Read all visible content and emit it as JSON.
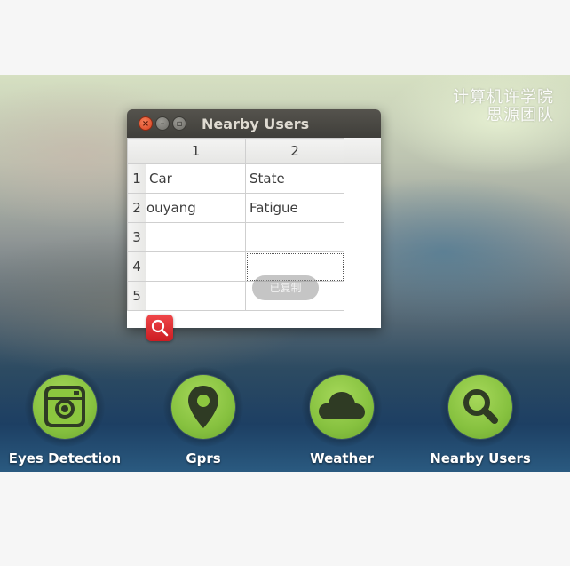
{
  "watermark": {
    "line1": "计算机许学院",
    "line2": "思源团队"
  },
  "window": {
    "title": "Nearby Users",
    "close_glyph": "×",
    "minimize_glyph": "–",
    "maximize_glyph": "▫"
  },
  "table": {
    "columns": [
      "1",
      "2"
    ],
    "rows": [
      {
        "header": "1",
        "cells": [
          "Car",
          "State"
        ]
      },
      {
        "header": "2",
        "cells": [
          "ouyang",
          "Fatigue"
        ]
      },
      {
        "header": "3",
        "cells": [
          "",
          ""
        ]
      },
      {
        "header": "4",
        "cells": [
          "",
          ""
        ]
      },
      {
        "header": "5",
        "cells": [
          "",
          ""
        ]
      }
    ]
  },
  "toast": {
    "text": "已复制"
  },
  "search_button": {
    "icon": "search-icon",
    "color": "#e0282e"
  },
  "dock": {
    "accent": "#8cc63f",
    "items": [
      {
        "label": "Eyes Detection",
        "icon": "camera-icon"
      },
      {
        "label": "Gprs",
        "icon": "map-pin-icon"
      },
      {
        "label": "Weather",
        "icon": "cloud-icon"
      },
      {
        "label": "Nearby Users",
        "icon": "search-icon"
      }
    ]
  }
}
